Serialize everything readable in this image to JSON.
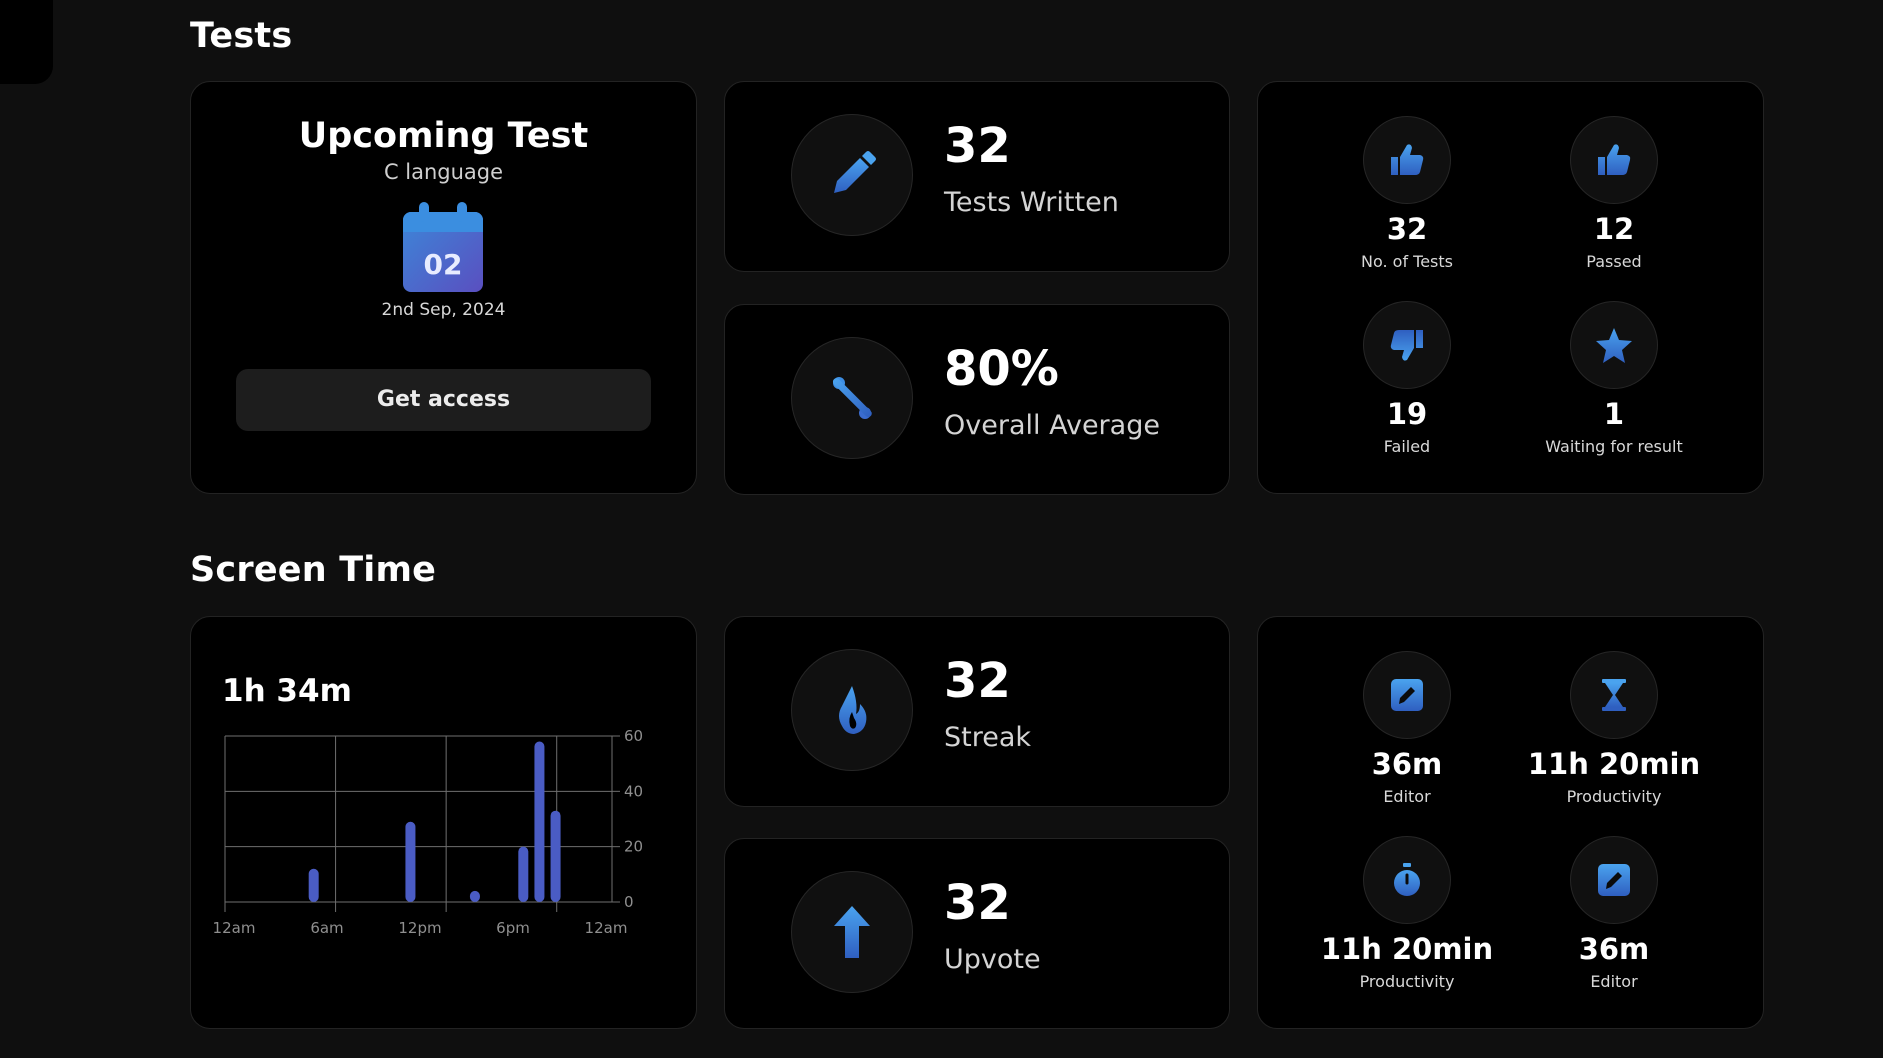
{
  "sections": {
    "tests_title": "Tests",
    "screen_time_title": "Screen Time"
  },
  "upcoming_test": {
    "title": "Upcoming Test",
    "subject": "C language",
    "calendar_day": "02",
    "date": "2nd Sep, 2024",
    "button_label": "Get access",
    "icon": "calendar-icon"
  },
  "tests_written": {
    "value": "32",
    "label": "Tests Written",
    "icon": "pencil-icon"
  },
  "overall_average": {
    "value": "80%",
    "label": "Overall Average",
    "icon": "percent-icon"
  },
  "test_summary": [
    {
      "value": "32",
      "label": "No. of Tests",
      "icon": "thumbs-up-icon"
    },
    {
      "value": "12",
      "label": "Passed",
      "icon": "thumbs-up-icon"
    },
    {
      "value": "19",
      "label": "Failed",
      "icon": "thumbs-down-icon"
    },
    {
      "value": "1",
      "label": "Waiting for result",
      "icon": "star-icon"
    }
  ],
  "screen_time": {
    "total": "1h 34m"
  },
  "chart_data": {
    "type": "bar",
    "title": "",
    "x": [
      5.5,
      11.5,
      15.5,
      18.5,
      19.5,
      20.5
    ],
    "values": [
      12,
      29,
      4,
      20,
      58,
      33
    ],
    "x_ticks": [
      "12am",
      "6am",
      "12pm",
      "6pm",
      "12am"
    ],
    "x_range": [
      0,
      24
    ],
    "y_ticks": [
      "60",
      "40",
      "20",
      "0"
    ],
    "ylim": [
      0,
      60
    ],
    "grid": true,
    "bar_color": "#4a5cc4"
  },
  "streak": {
    "value": "32",
    "label": "Streak",
    "icon": "flame-icon"
  },
  "upvote": {
    "value": "32",
    "label": "Upvote",
    "icon": "arrow-up-icon"
  },
  "time_summary": [
    {
      "value": "36m",
      "label": "Editor",
      "icon": "edit-icon"
    },
    {
      "value": "11h 20min",
      "label": "Productivity",
      "icon": "hourglass-icon"
    },
    {
      "value": "11h 20min",
      "label": "Productivity",
      "icon": "stopwatch-icon"
    },
    {
      "value": "36m",
      "label": "Editor",
      "icon": "edit-icon"
    }
  ],
  "colors": {
    "background": "#0f0f0f",
    "card": "#000000",
    "accent_blue": "#3a7bd5",
    "accent_indigo": "#4a5cc4"
  }
}
